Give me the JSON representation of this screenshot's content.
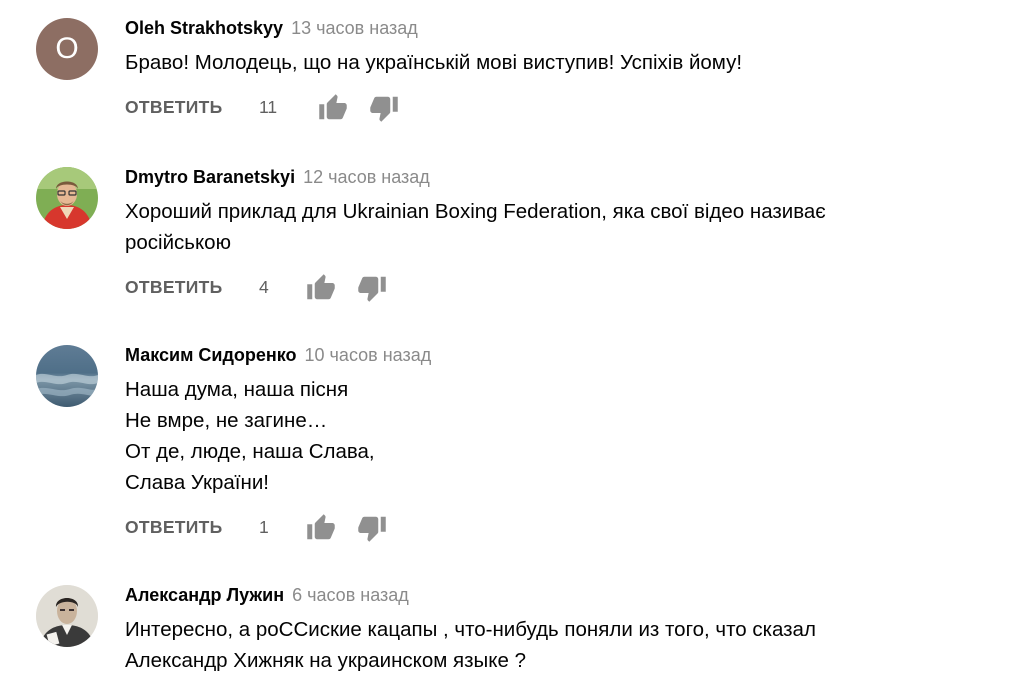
{
  "comments": [
    {
      "author": "Oleh Strakhotskyy",
      "time": "13 часов назад",
      "avatar_letter": "O",
      "avatar_color": "#8d6e63",
      "text_lines": [
        "Браво! Молодець, що на українській мові виступив! Успіхів йому!"
      ],
      "reply_label": "ОТВЕТИТЬ",
      "likes": "11"
    },
    {
      "author": "Dmytro Baranetskyi",
      "time": "12 часов назад",
      "avatar_letter": "",
      "text_lines": [
        "Хороший приклад для Ukrainian Boxing Federation, яка свої відео називає",
        "російською"
      ],
      "reply_label": "ОТВЕТИТЬ",
      "likes": "4"
    },
    {
      "author": "Максим Сидоренко",
      "time": "10 часов назад",
      "avatar_letter": "",
      "text_lines": [
        "Наша дума, наша пісня",
        "Не вмре, не загине…",
        "От де, люде, наша Слава,",
        "Слава України!"
      ],
      "reply_label": "ОТВЕТИТЬ",
      "likes": "1"
    },
    {
      "author": "Александр Лужин",
      "time": "6 часов назад",
      "avatar_letter": "",
      "text_lines": [
        "Интересно, а  роССиские кацапы , что-нибудь поняли из того, что сказал",
        "Александр Хижняк на украинском языке ?"
      ],
      "reply_label": "",
      "likes": ""
    }
  ],
  "icons": {
    "like": "thumbs-up-icon",
    "dislike": "thumbs-down-icon"
  },
  "colors": {
    "meta_text": "#8a8a8a",
    "action_text": "#606060",
    "icon": "#909090"
  }
}
